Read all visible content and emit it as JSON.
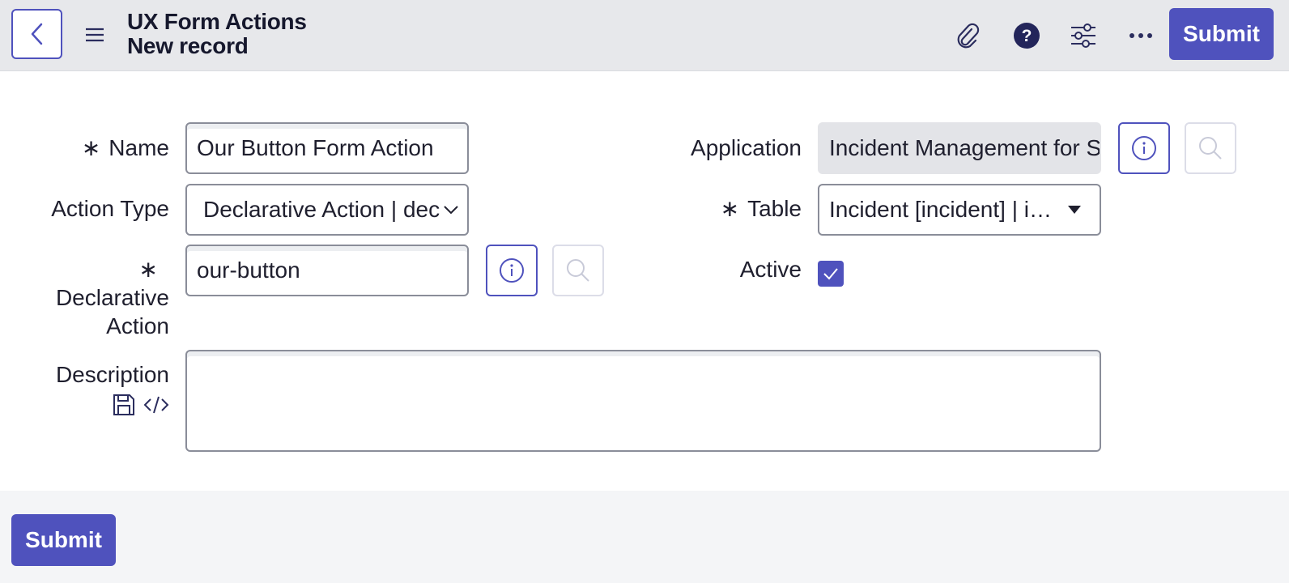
{
  "header": {
    "title": "UX Form Actions",
    "subtitle": "New record",
    "back_icon": "chevron-left-icon",
    "menu_icon": "hamburger-icon",
    "icons": [
      "paperclip-icon",
      "help-icon",
      "sliders-icon",
      "more-icon"
    ],
    "submit_label": "Submit"
  },
  "form": {
    "name": {
      "label": "Name",
      "required": "∗",
      "value": "Our Button Form Action"
    },
    "action_type": {
      "label": "Action Type",
      "value": "Declarative Action | dec"
    },
    "declarative_action": {
      "label_line1": "Declarative",
      "label_line2": "Action",
      "required": "∗",
      "value": "our-button"
    },
    "application": {
      "label": "Application",
      "value": "Incident Management for S"
    },
    "table": {
      "label": "Table",
      "required": "∗",
      "value": "Incident [incident] | i…"
    },
    "active": {
      "label": "Active",
      "checked": true
    },
    "description": {
      "label": "Description",
      "value": ""
    }
  },
  "footer": {
    "submit_label": "Submit"
  },
  "colors": {
    "accent": "#4f52bd",
    "header_bg": "#e7e8eb",
    "readonly_bg": "#e3e4e8"
  }
}
